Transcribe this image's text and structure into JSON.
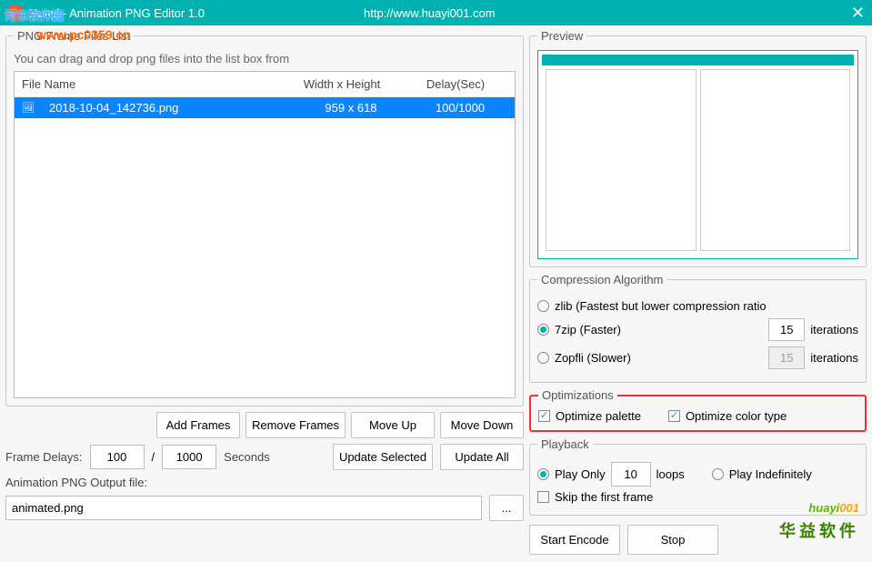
{
  "titlebar": {
    "title": "Huayi - Animation PNG Editor 1.0",
    "url": "http://www.huayi001.com"
  },
  "watermark": {
    "text1": "河东软件园",
    "text2": "www.pc0359.cn"
  },
  "framelist": {
    "legend": "PNG Frame Files List",
    "hint": "You can drag and drop png files into the list box from",
    "cols": {
      "name": "File Name",
      "dim": "Width x Height",
      "delay": "Delay(Sec)"
    },
    "rows": [
      {
        "name": "2018-10-04_142736.png",
        "dim": "959 x 618",
        "delay": "100/1000"
      }
    ]
  },
  "btns": {
    "add": "Add Frames",
    "remove": "Remove Frames",
    "up": "Move Up",
    "down": "Move Down",
    "updateSel": "Update Selected",
    "updateAll": "Update All",
    "browse": "...",
    "start": "Start Encode",
    "stop": "Stop"
  },
  "delays": {
    "label": "Frame Delays:",
    "num": "100",
    "denom": "1000",
    "seconds": "Seconds",
    "slash": "/"
  },
  "output": {
    "label": "Animation PNG Output file:",
    "value": "animated.png"
  },
  "preview": {
    "legend": "Preview"
  },
  "comp": {
    "legend": "Compression Algorithm",
    "zlib": "zlib (Fastest but lower compression ratio",
    "zip": "7zip (Faster)",
    "zopfli": "Zopfli (Slower)",
    "iterations": "iterations",
    "zipIter": "15",
    "zopfliIter": "15"
  },
  "opt": {
    "legend": "Optimizations",
    "palette": "Optimize palette",
    "colortype": "Optimize color type"
  },
  "playback": {
    "legend": "Playback",
    "playOnly": "Play Only",
    "loopsVal": "10",
    "loops": "loops",
    "indef": "Play Indefinitely",
    "skip": "Skip the first frame"
  },
  "brand": {
    "t1a": "huayi",
    "t1b": "001",
    "t2": "华益软件"
  }
}
